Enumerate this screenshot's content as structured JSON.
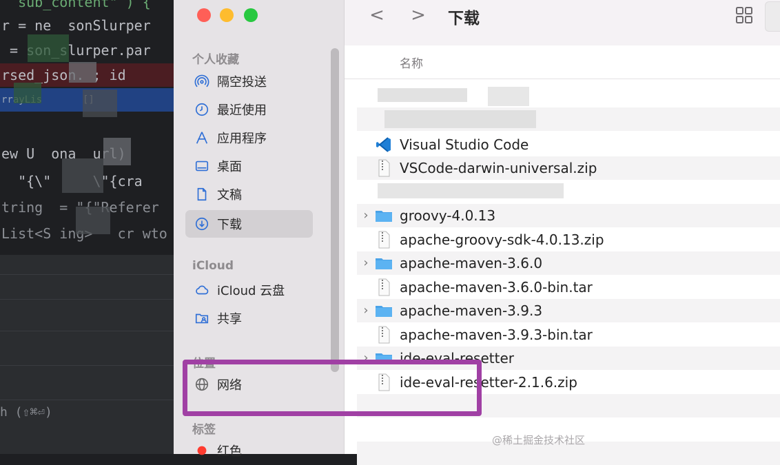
{
  "ide": {
    "lines": [
      {
        "text": "  sub_content\" ) {"
      },
      {
        "text": "r = ne  sonSlurper"
      },
      {
        "text": " = son_slurper.par"
      },
      {
        "text": "rsed_json. ; id"
      },
      {
        "text": "rrayLis       []"
      },
      {
        "text": "ew U  ona  url)"
      },
      {
        "text": "  \"{\\\"     \\\"{cra"
      },
      {
        "text": "tring  = \"{\"Referer"
      },
      {
        "text": "List<S ing>   cr wto"
      }
    ],
    "shortcut": "h (⇧⌘⏎)"
  },
  "finder": {
    "sidebar": {
      "sections": [
        {
          "title": "个人收藏"
        },
        {
          "title": "iCloud"
        },
        {
          "title": "位置"
        },
        {
          "title": "标签"
        }
      ],
      "items": [
        {
          "label": "隔空投送",
          "icon": "airdrop-icon"
        },
        {
          "label": "最近使用",
          "icon": "clock-icon"
        },
        {
          "label": "应用程序",
          "icon": "applications-icon"
        },
        {
          "label": "桌面",
          "icon": "desktop-icon"
        },
        {
          "label": "文稿",
          "icon": "document-icon"
        },
        {
          "label": "下载",
          "icon": "download-icon",
          "selected": true
        },
        {
          "label": "iCloud 云盘",
          "icon": "cloud-icon"
        },
        {
          "label": "共享",
          "icon": "shared-folder-icon"
        },
        {
          "label": "网络",
          "icon": "globe-icon"
        },
        {
          "label": "红色",
          "icon": "red-tag-icon",
          "color": "#ff3b30"
        }
      ]
    },
    "toolbar": {
      "back": "<",
      "forward": ">",
      "title": "下载"
    },
    "column_header": "名称",
    "files": [
      {
        "name": "",
        "kind": "redacted"
      },
      {
        "name": "",
        "kind": "redacted"
      },
      {
        "name": "Visual Studio Code",
        "kind": "app"
      },
      {
        "name": "VSCode-darwin-universal.zip",
        "kind": "zip"
      },
      {
        "name": "",
        "kind": "redacted"
      },
      {
        "name": "groovy-4.0.13",
        "kind": "folder"
      },
      {
        "name": "apache-groovy-sdk-4.0.13.zip",
        "kind": "zip"
      },
      {
        "name": "apache-maven-3.6.0",
        "kind": "folder"
      },
      {
        "name": "apache-maven-3.6.0-bin.tar",
        "kind": "file"
      },
      {
        "name": "apache-maven-3.9.3",
        "kind": "folder"
      },
      {
        "name": "apache-maven-3.9.3-bin.tar",
        "kind": "file"
      },
      {
        "name": "ide-eval-resetter",
        "kind": "folder"
      },
      {
        "name": "ide-eval-resetter-2.1.6.zip",
        "kind": "zip",
        "highlighted": true
      }
    ],
    "highlight_color": "#a040a4"
  },
  "watermark": "@稀土掘金技术社区"
}
